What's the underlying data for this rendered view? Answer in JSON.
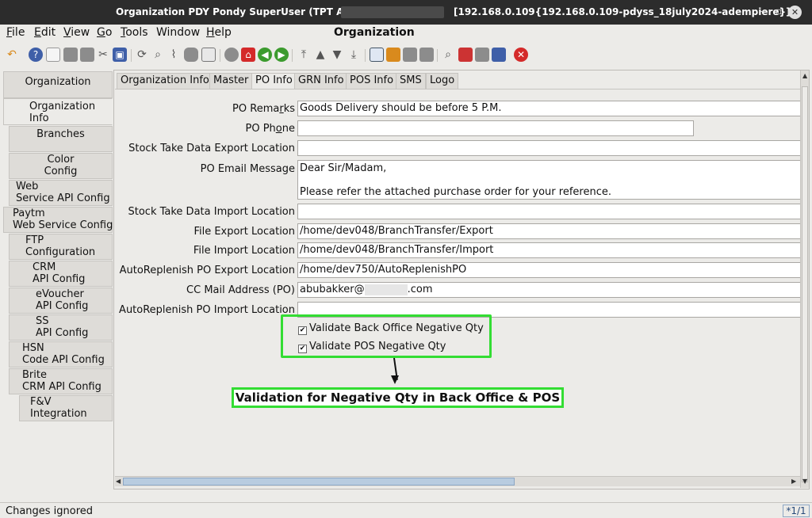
{
  "titlebar": {
    "left_text": "Organization  PDY  Pondy  SuperUser (TPT Admin) @",
    "right_text": "[192.168.0.109{192.168.0.109-pdyss_18july2024-adempiere}]",
    "minimize": "–",
    "maximize": "▫",
    "close": "✕"
  },
  "menu": {
    "file": "File",
    "edit": "Edit",
    "view": "View",
    "go": "Go",
    "tools": "Tools",
    "window": "Window",
    "help": "Help",
    "window_title": "Organization"
  },
  "sidebar": {
    "organization": "Organization",
    "org_info_1": "Organization",
    "org_info_2": "Info",
    "branches": "Branches",
    "color_1": "Color",
    "color_2": "Config",
    "web_1": "Web",
    "web_2": "Service API Config",
    "paytm_1": "Paytm",
    "paytm_2": "Web Service Config",
    "ftp_1": "FTP",
    "ftp_2": "Configuration",
    "crm_1": "CRM",
    "crm_2": "API Config",
    "ev_1": "eVoucher",
    "ev_2": "API Config",
    "ss_1": "SS",
    "ss_2": "API Config",
    "hsn_1": "HSN",
    "hsn_2": "Code API Config",
    "brite_1": "Brite",
    "brite_2": "CRM API Config",
    "fv_1": "F&V",
    "fv_2": "Integration"
  },
  "tabs": {
    "org_info": "Organization Info",
    "master": "Master",
    "po_info": "PO Info",
    "grn_info": "GRN Info",
    "pos_info": "POS Info",
    "sms": "SMS",
    "logo": "Logo"
  },
  "form": {
    "po_remarks_label_a": "PO Rema",
    "po_remarks_label_u": "r",
    "po_remarks_label_b": "ks",
    "po_remarks_value": "Goods Delivery should be before 5 P.M.",
    "po_phone_label_a": "PO Ph",
    "po_phone_label_u": "o",
    "po_phone_label_b": "ne",
    "po_phone_value": "",
    "stock_export_label": "Stock Take Data Export Location",
    "stock_export_value": "",
    "po_email_label": "PO Email Message",
    "po_email_value": "Dear Sir/Madam,\n\nPlease refer the attached purchase order for your reference.",
    "stock_import_label": "Stock Take Data Import Location",
    "stock_import_value": "",
    "file_export_label": "File Export Location",
    "file_export_value": "/home/dev048/BranchTransfer/Export",
    "file_import_label": "File Import Location",
    "file_import_value": "/home/dev048/BranchTransfer/Import",
    "auto_export_label": "AutoReplenish PO Export Location",
    "auto_export_value": "/home/dev750/AutoReplenishPO",
    "cc_mail_label": "CC Mail Address (PO)",
    "cc_mail_prefix": "abubakker@",
    "cc_mail_suffix": ".com",
    "auto_import_label": "AutoReplenish PO Import Location",
    "auto_import_value": "",
    "validate_bo_label": "Validate Back Office Negative Qty",
    "validate_bo_checked": true,
    "validate_pos_label": "Validate POS Negative Qty",
    "validate_pos_checked": true,
    "check_mark": "✔"
  },
  "annotation": {
    "callout": "Validation for Negative Qty in Back Office & POS",
    "highlight_color": "#33dd33"
  },
  "status": {
    "message": "Changes ignored",
    "record": "*1/1"
  },
  "toolbar_icons": [
    "undo-icon",
    "help-icon",
    "new-icon",
    "copy-icon",
    "delete-icon",
    "delete-selection-icon",
    "save-icon",
    "refresh-icon",
    "find-icon",
    "attachment-icon",
    "chat-icon",
    "grid-toggle-icon",
    "history-icon",
    "home-icon",
    "back-icon",
    "forward-icon",
    "first-record-icon",
    "previous-record-icon",
    "next-record-icon",
    "last-record-icon",
    "report-icon",
    "archive-icon",
    "print-preview-icon",
    "print-icon",
    "zoom-across-icon",
    "active-workflows-icon",
    "requests-icon",
    "product-info-icon",
    "close-window-icon"
  ]
}
